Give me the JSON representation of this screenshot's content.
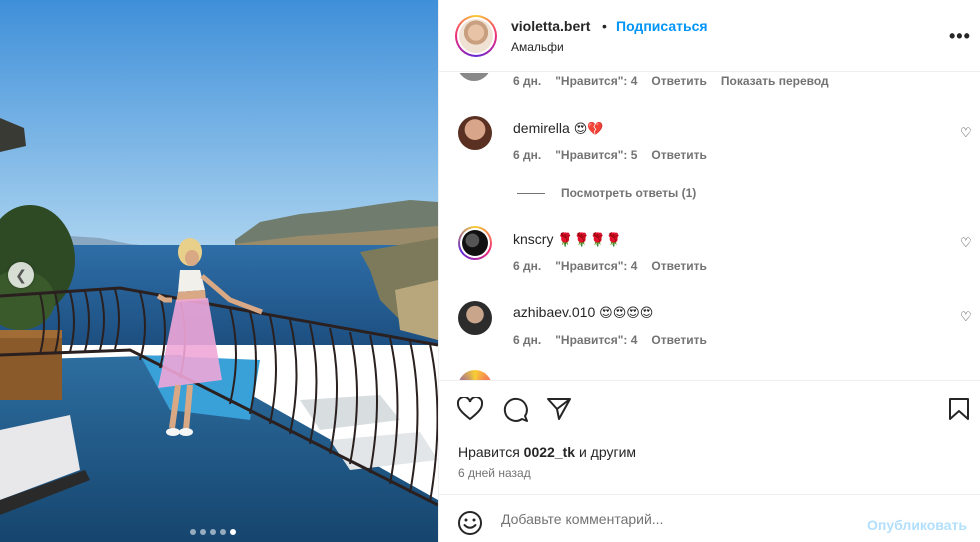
{
  "header": {
    "username": "violetta.bert",
    "bullet": "•",
    "follow_label": "Подписаться",
    "location": "Амальфи",
    "more": "•••"
  },
  "comments": {
    "first_meta": {
      "time": "6 дн.",
      "likes": "\"Нравится\": 4",
      "reply": "Ответить",
      "translate": "Показать перевод"
    },
    "items": [
      {
        "name": "demirella",
        "emoji": "😍💔",
        "time": "6 дн.",
        "likes": "\"Нравится\": 5",
        "reply": "Ответить"
      },
      {
        "name": "knscry",
        "emoji": "🌹🌹🌹🌹",
        "time": "6 дн.",
        "likes": "\"Нравится\": 4",
        "reply": "Ответить"
      },
      {
        "name": "azhibaev.010",
        "emoji": "😍😍😍😍",
        "time": "6 дн.",
        "likes": "\"Нравится\": 4",
        "reply": "Ответить"
      }
    ],
    "view_replies": "Посмотреть ответы (1)"
  },
  "actions": {
    "likes_prefix": "Нравится",
    "likes_user": "0022_tk",
    "likes_suffix": "и другим",
    "time": "6 дней назад"
  },
  "comment_bar": {
    "placeholder": "Добавьте комментарий...",
    "publish_label": "Опубликовать"
  },
  "carousel": {
    "total_slides": 5,
    "active_slide": 5,
    "prev_icon": "chevron-left-icon"
  },
  "colors": {
    "link_blue": "#0095f6",
    "publish_disabled": "#b2dffc",
    "meta_gray": "#737373",
    "text": "#262626"
  }
}
